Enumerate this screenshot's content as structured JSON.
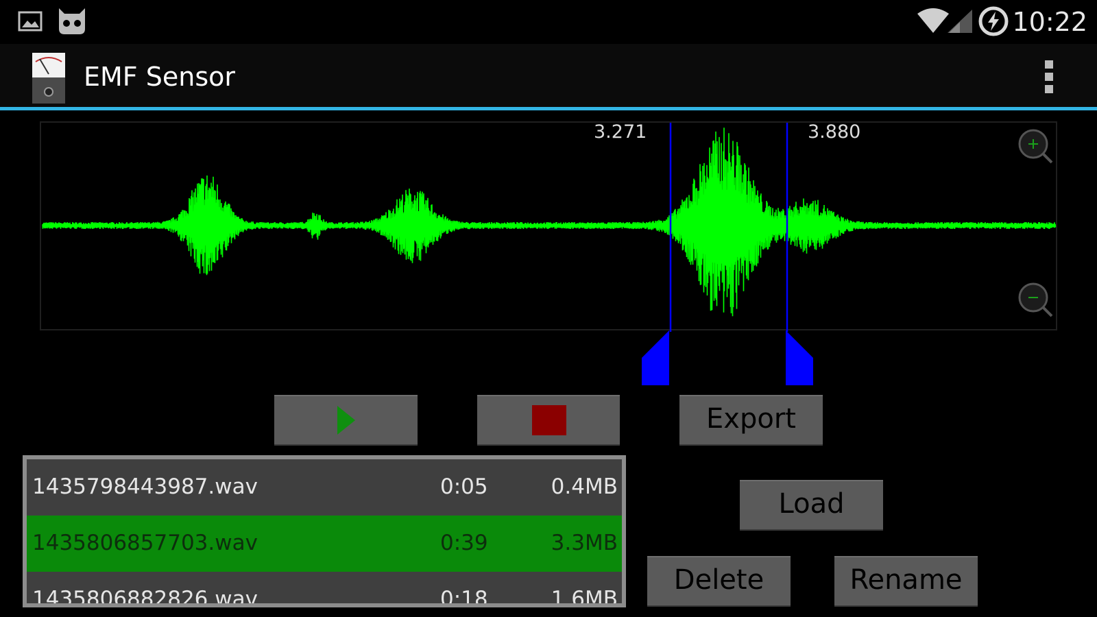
{
  "status_bar": {
    "time": "10:22",
    "icons": [
      "gallery-icon",
      "cyanogen-mascot-icon",
      "wifi-icon",
      "cell-signal-icon",
      "battery-charging-icon"
    ]
  },
  "action_bar": {
    "title": "EMF Sensor",
    "app_icon": "emf-meter-icon",
    "overflow_icon": "overflow-menu-icon",
    "accent_color": "#33b5e5"
  },
  "waveform": {
    "wave_color": "#00ff00",
    "marker_color": "#0000ff",
    "marker_start_label": "3.271",
    "marker_end_label": "3.880",
    "zoom_in_icon": "zoom-in-icon",
    "zoom_out_icon": "zoom-out-icon"
  },
  "controls": {
    "play_icon": "play-icon",
    "stop_icon": "stop-icon",
    "export_label": "Export",
    "load_label": "Load",
    "delete_label": "Delete",
    "rename_label": "Rename"
  },
  "files": [
    {
      "name": "1435798443987.wav",
      "duration": "0:05",
      "size": "0.4MB",
      "selected": false
    },
    {
      "name": "1435806857703.wav",
      "duration": "0:39",
      "size": "3.3MB",
      "selected": true
    },
    {
      "name": "1435806882826.wav",
      "duration": "0:18",
      "size": "1.6MB",
      "selected": false
    }
  ]
}
